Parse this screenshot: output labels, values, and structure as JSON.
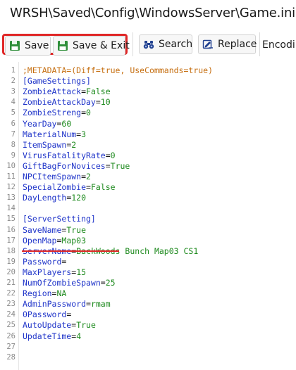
{
  "window": {
    "title": "WRSH\\Saved\\Config\\WindowsServer\\Game.ini"
  },
  "toolbar": {
    "save_label": "Save",
    "save_exit_label": "Save & Exit",
    "search_label": "Search",
    "replace_label": "Replace",
    "encoding_label": "Encodi"
  },
  "colors": {
    "highlight_box": "#e02727",
    "comment": "#c66f11",
    "key": "#1f34c9",
    "value": "#1e8a1e"
  },
  "icons": {
    "save": "floppy-disk-icon",
    "save_exit": "floppy-disk-icon",
    "search": "binoculars-icon",
    "replace": "replace-icon"
  },
  "editor": {
    "lines": [
      {
        "n": "1",
        "type": "comment",
        "text": ";METADATA=(Diff=true, UseCommands=true)"
      },
      {
        "n": "2",
        "type": "section",
        "text": "[GameSettings]"
      },
      {
        "n": "3",
        "type": "kv",
        "key": "ZombieAttack",
        "value": "False"
      },
      {
        "n": "4",
        "type": "kv",
        "key": "ZombieAttackDay",
        "value": "10"
      },
      {
        "n": "5",
        "type": "kv",
        "key": "ZombieStreng",
        "value": "0"
      },
      {
        "n": "6",
        "type": "kv",
        "key": "YearDay",
        "value": "60"
      },
      {
        "n": "7",
        "type": "kv",
        "key": "MaterialNum",
        "value": "3"
      },
      {
        "n": "8",
        "type": "kv",
        "key": "ItemSpawn",
        "value": "2"
      },
      {
        "n": "9",
        "type": "kv",
        "key": "VirusFatalityRate",
        "value": "0"
      },
      {
        "n": "10",
        "type": "kv",
        "key": "GiftBagForNovices",
        "value": "True"
      },
      {
        "n": "11",
        "type": "kv",
        "key": "NPCItemSpawn",
        "value": "2"
      },
      {
        "n": "12",
        "type": "kv",
        "key": "SpecialZombie",
        "value": "False"
      },
      {
        "n": "13",
        "type": "kv",
        "key": "DayLength",
        "value": "120"
      },
      {
        "n": "14",
        "type": "empty",
        "text": ""
      },
      {
        "n": "15",
        "type": "section",
        "text": "[ServerSetting]"
      },
      {
        "n": "16",
        "type": "kv",
        "key": "SaveName",
        "value": "True"
      },
      {
        "n": "17",
        "type": "kv",
        "key": "OpenMap",
        "value": "Map03"
      },
      {
        "n": "18",
        "type": "kv",
        "key": "ServerName",
        "value": "BackWoods Bunch Map03 CS1"
      },
      {
        "n": "19",
        "type": "kv",
        "key": "Password",
        "value": ""
      },
      {
        "n": "20",
        "type": "kv",
        "key": "MaxPlayers",
        "value": "15"
      },
      {
        "n": "21",
        "type": "kv",
        "key": "NumOfZombieSpawn",
        "value": "25"
      },
      {
        "n": "22",
        "type": "kv",
        "key": "Region",
        "value": "NA"
      },
      {
        "n": "23",
        "type": "kv",
        "key": "AdminPassword",
        "value": "rmam"
      },
      {
        "n": "24",
        "type": "kv",
        "key": "0Password",
        "value": ""
      },
      {
        "n": "25",
        "type": "kv",
        "key": "AutoUpdate",
        "value": "True"
      },
      {
        "n": "26",
        "type": "kv",
        "key": "UpdateTime",
        "value": "4"
      },
      {
        "n": "27",
        "type": "empty",
        "text": ""
      },
      {
        "n": "28",
        "type": "empty",
        "text": ""
      }
    ]
  }
}
